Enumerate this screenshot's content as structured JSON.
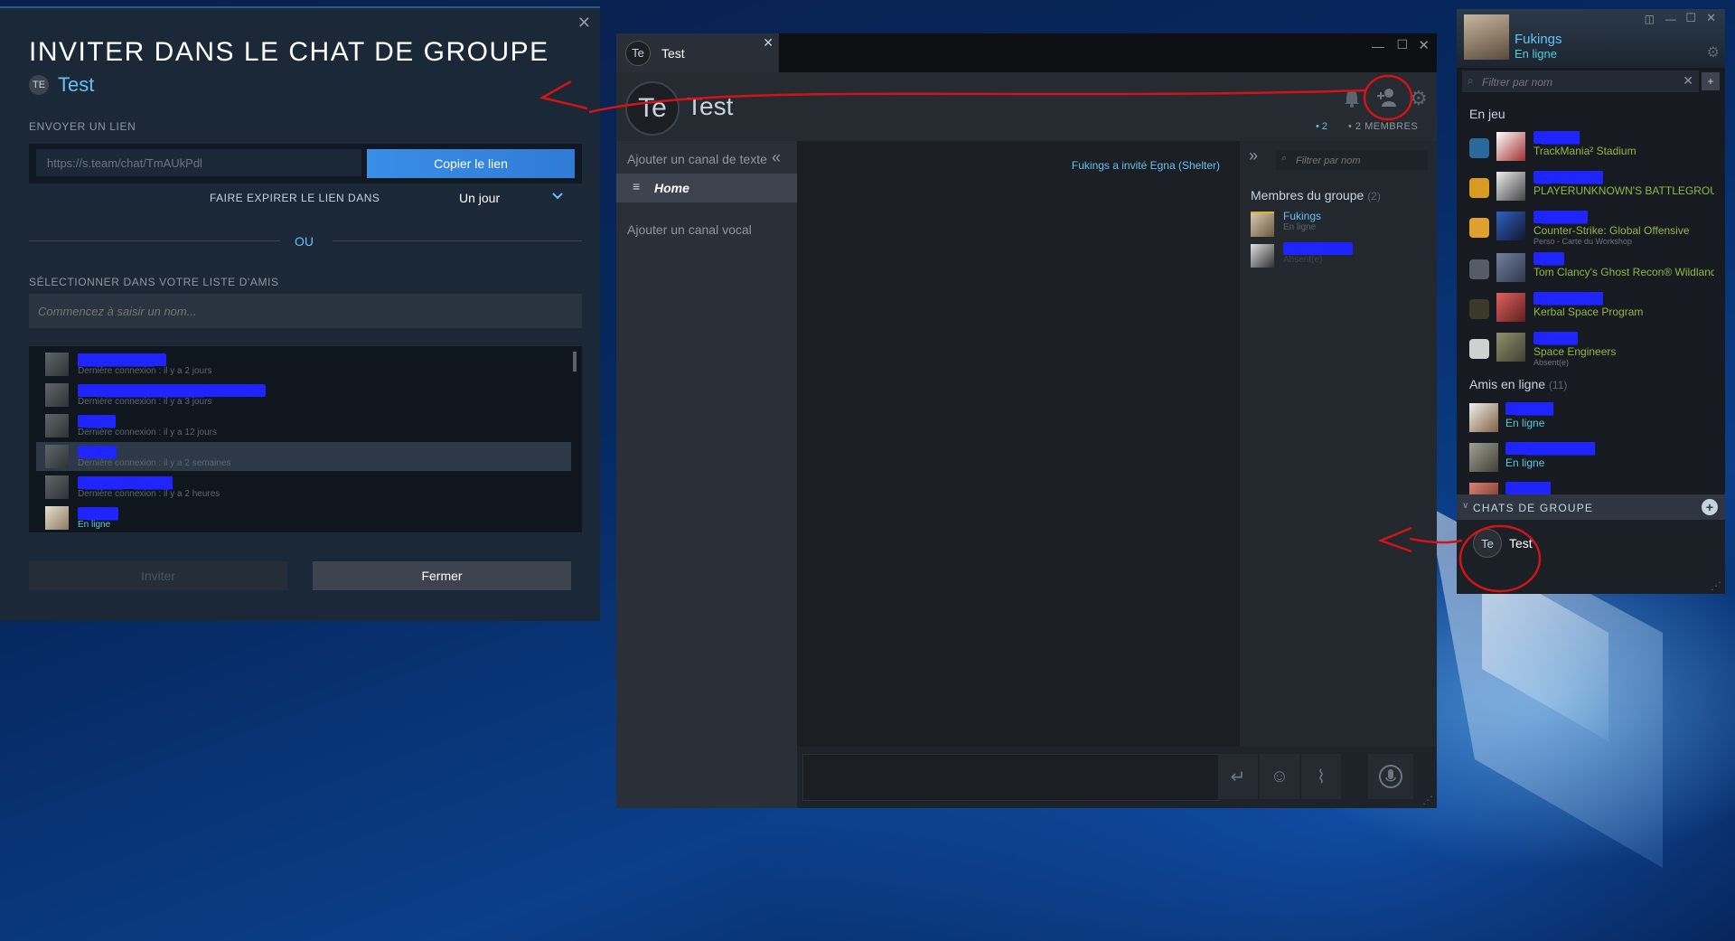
{
  "invite": {
    "title": "INVITER DANS LE CHAT DE GROUPE",
    "group_initials": "TE",
    "group_name": "Test",
    "send_link_label": "ENVOYER UN LIEN",
    "link_value": "https://s.team/chat/TmAUkPdl",
    "copy_link_button": "Copier le lien",
    "expire_label": "FAIRE EXPIRER LE LIEN DANS :",
    "expire_value": "Un jour",
    "or_label": "OU",
    "select_friends_label": "SÉLECTIONNER DANS VOTRE LISTE D'AMIS",
    "search_placeholder": "Commencez à saisir un nom...",
    "friends": [
      {
        "name": "██████████ne",
        "status": "Dernière connexion : il y a 2 jours"
      },
      {
        "name": "LETT█████████████ CATSE.com",
        "status": "Dernière connexion : il y a 3 jours"
      },
      {
        "name": "C██T█",
        "status": "Dernière connexion : il y a 12 jours"
      },
      {
        "name": "C█R██",
        "status": "Dernière connexion : il y a 2 semaines"
      },
      {
        "name": "A█████ C█████",
        "status": "Dernière connexion : il y a 2 heures"
      },
      {
        "name": "Al████",
        "status": "En ligne"
      }
    ],
    "invite_button": "Inviter",
    "close_button": "Fermer"
  },
  "chat": {
    "tab_initials": "Te",
    "tab_title": "Test",
    "group_initials": "Te",
    "group_name": "Test",
    "online_count": "2",
    "member_count": "2 MEMBRES",
    "add_text_channel": "Ajouter un canal de texte",
    "home_channel": "Home",
    "add_voice_channel": "Ajouter un canal vocal",
    "system_message": "Fukings a invité Egna (Shelter)",
    "member_filter_placeholder": "Filtrer par nom",
    "members_header": "Membres du groupe",
    "members_count": "(2)",
    "members": [
      {
        "name": "Fukings",
        "status": "En ligne"
      },
      {
        "name": "Egna (Shelter)",
        "status": "Absent(e)"
      }
    ]
  },
  "friends": {
    "user_name": "Fukings",
    "user_status": "En ligne",
    "filter_placeholder": "Filtrer par nom",
    "in_game_header": "En jeu",
    "in_game": [
      {
        "name": "C█████",
        "game": "TrackMania² Stadium",
        "sub": "",
        "icon_color": "#2a6a9a"
      },
      {
        "name": "i██ W█████",
        "game": "PLAYERUNKNOWN'S BATTLEGROUNDS",
        "sub": "",
        "icon_color": "#d89a20"
      },
      {
        "name": "C██████",
        "game": "Counter-Strike: Global Offensive",
        "sub": "Perso - Carte du Workshop",
        "icon_color": "#e0a030"
      },
      {
        "name": "P███",
        "game": "Tom Clancy's Ghost Recon® Wildlands",
        "sub": "",
        "icon_color": "#555c66"
      },
      {
        "name": "R████████",
        "game": "Kerbal Space Program",
        "sub": "",
        "icon_color": "#3a3a2a"
      },
      {
        "name": "J█████",
        "game": "Space Engineers",
        "sub": "Absent(e)",
        "icon_color": "#d0d0d0"
      }
    ],
    "online_header": "Amis en ligne",
    "online_count": "(11)",
    "online": [
      {
        "name": "Al█████",
        "status": "En ligne"
      },
      {
        "name": "El C█████████",
        "status": "En ligne"
      },
      {
        "name": "F█████",
        "status": ""
      }
    ],
    "group_chats_header": "CHATS DE GROUPE",
    "group_chats": [
      {
        "initials": "Te",
        "name": "Test"
      }
    ]
  }
}
